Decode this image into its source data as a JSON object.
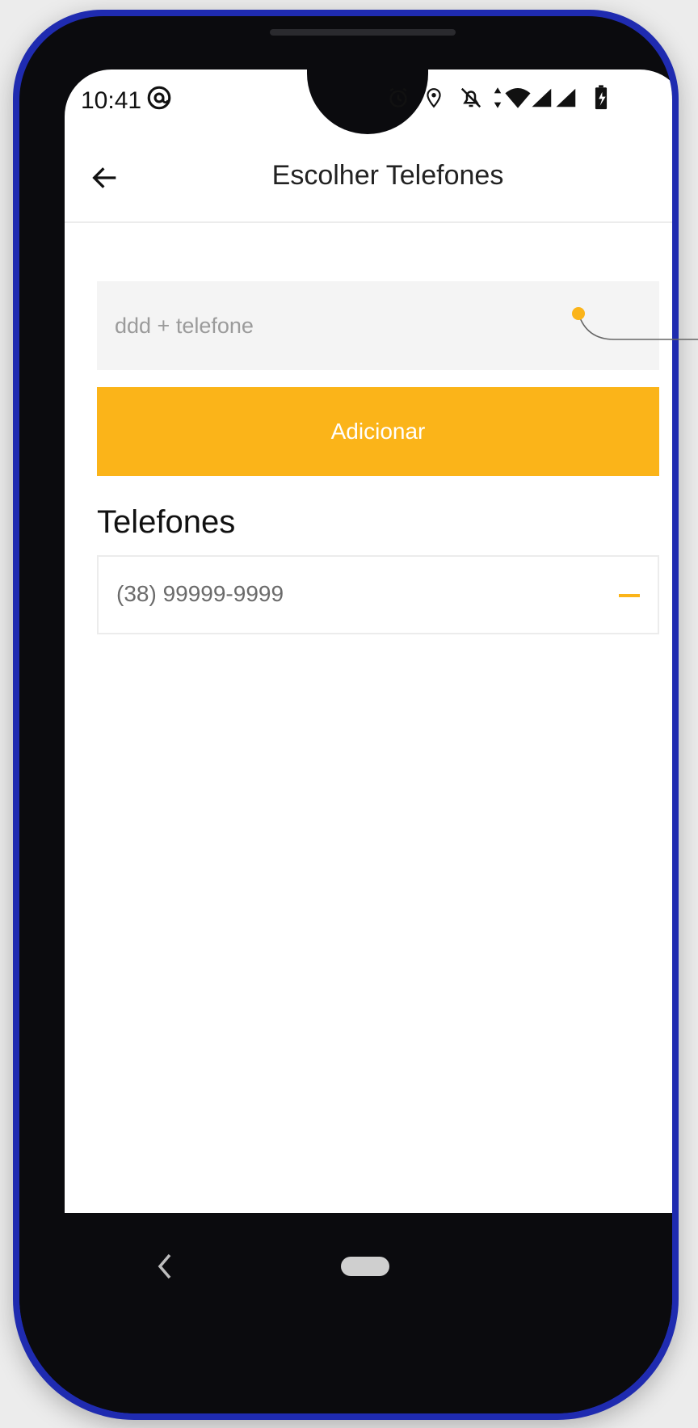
{
  "status_bar": {
    "time": "10:41",
    "icons": [
      "at-sign-icon",
      "alarm-icon",
      "location-icon",
      "notifications-off-icon",
      "data-arrows-icon",
      "wifi-icon",
      "signal-icon",
      "signal-icon",
      "battery-icon"
    ]
  },
  "header": {
    "title": "Escolher Telefones",
    "back_icon": "arrow-left-icon"
  },
  "form": {
    "phone_input": {
      "value": "",
      "placeholder": "ddd + telefone"
    },
    "add_button_label": "Adicionar"
  },
  "phones_section": {
    "title": "Telefones",
    "items": [
      {
        "number": "(38) 99999-9999",
        "action_icon": "minus-icon"
      }
    ]
  },
  "navigation": {
    "back_icon": "chevron-left-icon",
    "home_icon": "home-pill-icon"
  },
  "colors": {
    "accent": "#fbb419",
    "device_frame": "#1f2bb0",
    "input_background": "#f4f4f4"
  }
}
